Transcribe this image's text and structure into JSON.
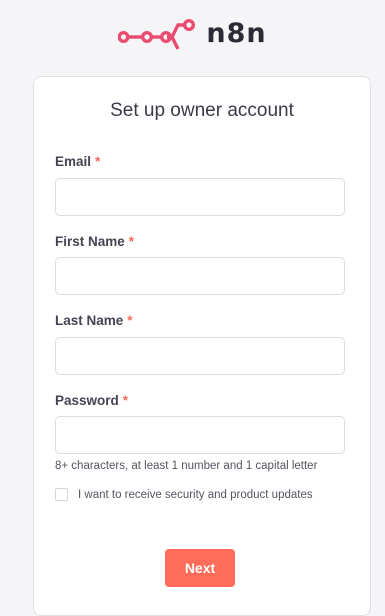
{
  "brand": {
    "name": "n8n",
    "accent_color": "#ea4b71",
    "logo_icon": "n8n-logo-icon"
  },
  "form": {
    "title": "Set up owner account",
    "required_marker": "*",
    "fields": {
      "email": {
        "label": "Email",
        "value": "",
        "placeholder": ""
      },
      "first_name": {
        "label": "First Name",
        "value": "",
        "placeholder": ""
      },
      "last_name": {
        "label": "Last Name",
        "value": "",
        "placeholder": ""
      },
      "password": {
        "label": "Password",
        "value": "",
        "placeholder": ""
      }
    },
    "password_hint": "8+ characters, at least 1 number and 1 capital letter",
    "updates_checkbox": {
      "label": "I want to receive security and product updates",
      "checked": false
    },
    "next_label": "Next",
    "button_color": "#ff6d5a"
  }
}
